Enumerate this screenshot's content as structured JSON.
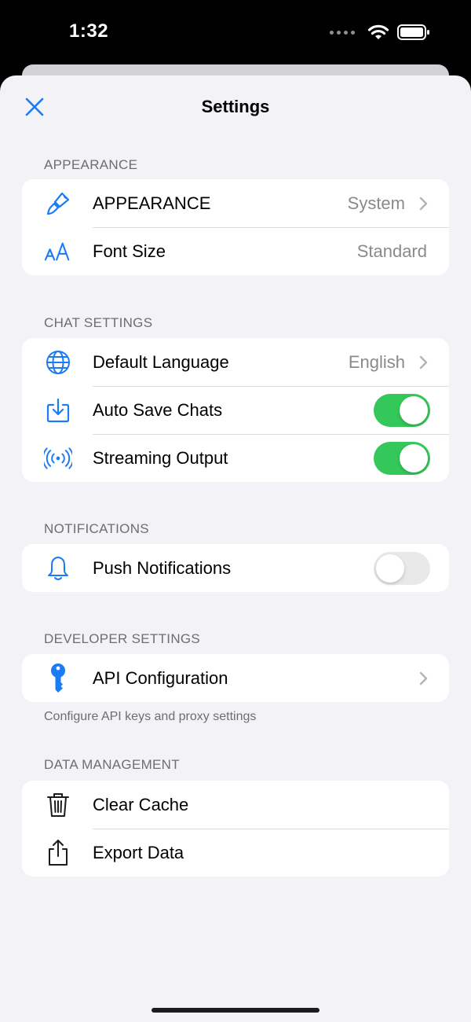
{
  "status_bar": {
    "time": "1:32"
  },
  "nav": {
    "title": "Settings",
    "close_icon": "close-x-icon"
  },
  "colors": {
    "accent": "#1a7cf5",
    "toggle_on": "#34c759",
    "toggle_off": "#e9e9ea"
  },
  "sections": {
    "appearance": {
      "header": "APPEARANCE",
      "rows": [
        {
          "icon": "paintbrush-icon",
          "label": "APPEARANCE",
          "value": "System",
          "chevron": true
        },
        {
          "icon": "text-size-icon",
          "label": "Font Size",
          "value": "Standard",
          "chevron": false
        }
      ]
    },
    "chat": {
      "header": "CHAT SETTINGS",
      "rows": [
        {
          "icon": "globe-icon",
          "label": "Default Language",
          "value": "English",
          "chevron": true
        },
        {
          "icon": "download-tray-icon",
          "label": "Auto Save Chats",
          "toggle": true
        },
        {
          "icon": "broadcast-icon",
          "label": "Streaming Output",
          "toggle": true
        }
      ]
    },
    "notifications": {
      "header": "NOTIFICATIONS",
      "rows": [
        {
          "icon": "bell-icon",
          "label": "Push Notifications",
          "toggle": false
        }
      ]
    },
    "developer": {
      "header": "DEVELOPER SETTINGS",
      "rows": [
        {
          "icon": "key-icon",
          "label": "API Configuration",
          "chevron": true
        }
      ],
      "footer": "Configure API keys and proxy settings"
    },
    "data": {
      "header": "DATA MANAGEMENT",
      "rows": [
        {
          "icon": "trash-icon",
          "label": "Clear Cache"
        },
        {
          "icon": "share-icon",
          "label": "Export Data"
        }
      ]
    }
  }
}
